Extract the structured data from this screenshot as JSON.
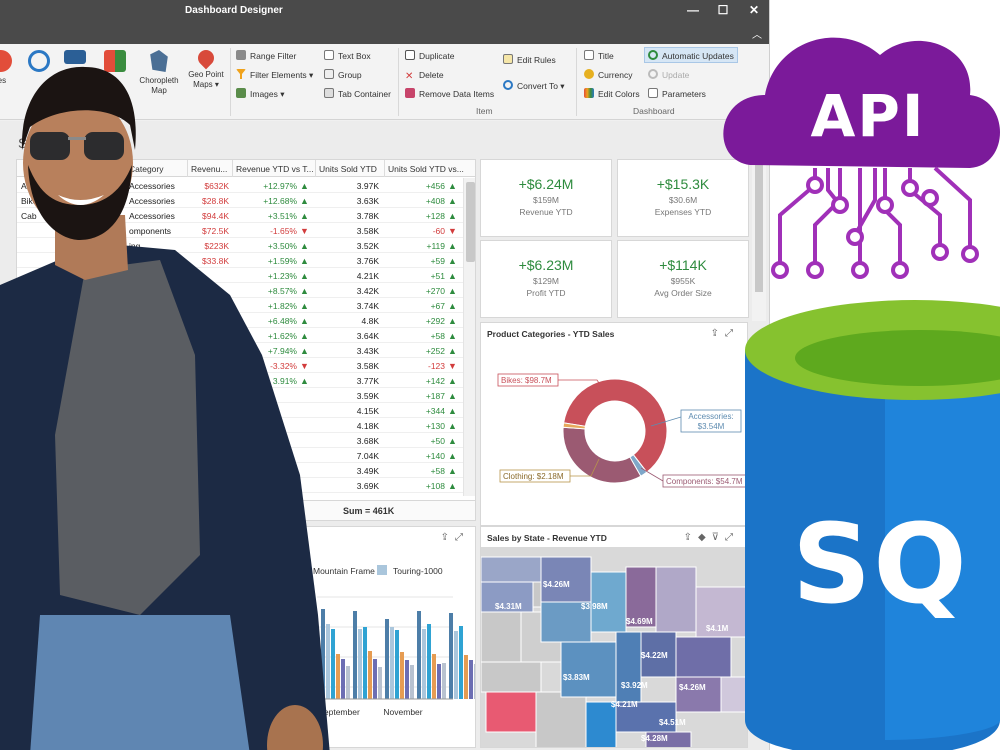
{
  "window": {
    "title": "Dashboard Designer",
    "controls": [
      "—",
      "☐",
      "✕"
    ],
    "ribbon_collapse": "︿"
  },
  "ribbon": {
    "big_buttons": [
      {
        "label": "ies"
      },
      {
        "label": ""
      },
      {
        "label": ""
      },
      {
        "label": "p"
      },
      {
        "label": "Choropleth Map"
      },
      {
        "label": "Geo Point Maps ▾"
      }
    ],
    "filter_group": [
      "Range Filter",
      "Filter Elements ▾",
      "Images ▾"
    ],
    "layout_group": [
      "Text Box",
      "Group",
      "Tab Container"
    ],
    "item_group": [
      "Duplicate",
      "Delete",
      "Remove Data Items",
      "Edit Rules",
      "Convert To ▾"
    ],
    "dashboard_group": [
      "Title",
      "Currency",
      "Edit Colors",
      "Automatic Updates",
      "Update",
      "Parameters"
    ],
    "group_labels": {
      "insert": "rt",
      "item": "Item",
      "dashboard": "Dashboard"
    }
  },
  "grid": {
    "partial_title": "S",
    "headers": [
      "Category",
      "Revenu...",
      "Revenue YTD vs T...",
      "Units Sold YTD",
      "Units Sold YTD vs..."
    ],
    "rows": [
      {
        "product": "A",
        "category": "Accessories",
        "rev": "$632K",
        "rev_neg": false,
        "vs": "+12.97%",
        "units": "3.97K",
        "uvs": "+456"
      },
      {
        "product": "Bike",
        "category": "Accessories",
        "rev": "$28.8K",
        "rev_neg": false,
        "vs": "+12.68%",
        "units": "3.63K",
        "uvs": "+408"
      },
      {
        "product": "Cab",
        "category": "Accessories",
        "rev": "$94.4K",
        "rev_neg": false,
        "vs": "+3.51%",
        "units": "3.78K",
        "uvs": "+128"
      },
      {
        "product": "",
        "category": "omponents",
        "rev": "$72.5K",
        "rev_neg": false,
        "vs": "-1.65%",
        "units": "3.58K",
        "uvs": "-60"
      },
      {
        "product": "",
        "category": "ing",
        "rev": "$223K",
        "rev_neg": false,
        "vs": "+3.50%",
        "units": "3.52K",
        "uvs": "+119"
      },
      {
        "product": "",
        "category": "",
        "rev": "$33.8K",
        "rev_neg": false,
        "vs": "+1.59%",
        "units": "3.76K",
        "uvs": "+59"
      },
      {
        "product": "",
        "category": "",
        "rev": "",
        "rev_neg": false,
        "vs": "+1.23%",
        "units": "4.21K",
        "uvs": "+51"
      },
      {
        "product": "",
        "category": "",
        "rev": "",
        "rev_neg": false,
        "vs": "+8.57%",
        "units": "3.42K",
        "uvs": "+270"
      },
      {
        "product": "",
        "category": "",
        "rev": "",
        "rev_neg": false,
        "vs": "+1.82%",
        "units": "3.74K",
        "uvs": "+67"
      },
      {
        "product": "",
        "category": "",
        "rev": "",
        "rev_neg": false,
        "vs": "+6.48%",
        "units": "4.8K",
        "uvs": "+292"
      },
      {
        "product": "",
        "category": "",
        "rev": "",
        "rev_neg": false,
        "vs": "+1.62%",
        "units": "3.64K",
        "uvs": "+58"
      },
      {
        "product": "",
        "category": "",
        "rev": "",
        "rev_neg": false,
        "vs": "+7.94%",
        "units": "3.43K",
        "uvs": "+252"
      },
      {
        "product": "",
        "category": "",
        "rev": "",
        "rev_neg": false,
        "vs": "-3.32%",
        "units": "3.58K",
        "uvs": "-123"
      },
      {
        "product": "",
        "category": "",
        "rev": "",
        "rev_neg": false,
        "vs": "3.91%",
        "units": "3.77K",
        "uvs": "+142"
      },
      {
        "product": "",
        "category": "",
        "rev": "",
        "rev_neg": false,
        "vs": "",
        "units": "3.59K",
        "uvs": "+187"
      },
      {
        "product": "",
        "category": "",
        "rev": "",
        "rev_neg": false,
        "vs": "",
        "units": "4.15K",
        "uvs": "+344"
      },
      {
        "product": "",
        "category": "",
        "rev": "",
        "rev_neg": false,
        "vs": "",
        "units": "4.18K",
        "uvs": "+130"
      },
      {
        "product": "",
        "category": "",
        "rev": "",
        "rev_neg": false,
        "vs": "",
        "units": "3.68K",
        "uvs": "+50"
      },
      {
        "product": "",
        "category": "",
        "rev": "",
        "rev_neg": false,
        "vs": "",
        "units": "7.04K",
        "uvs": "+140"
      },
      {
        "product": "",
        "category": "",
        "rev": "",
        "rev_neg": false,
        "vs": "",
        "units": "3.49K",
        "uvs": "+58"
      },
      {
        "product": "",
        "category": "",
        "rev": "",
        "rev_neg": false,
        "vs": "",
        "units": "3.69K",
        "uvs": "+108"
      }
    ],
    "sum": "Sum = 461K"
  },
  "cards": [
    {
      "value": "+$6.24M",
      "sub": "$159M",
      "label": "Revenue YTD"
    },
    {
      "value": "+$15.3K",
      "sub": "$30.6M",
      "label": "Expenses YTD"
    },
    {
      "value": "+$6.23M",
      "sub": "$129M",
      "label": "Profit YTD"
    },
    {
      "value": "+$114K",
      "sub": "$955K",
      "label": "Avg Order Size"
    }
  ],
  "pie": {
    "title": "Product Categories - YTD Sales",
    "labels": {
      "bikes": "Bikes: $98.7M",
      "accessories_1": "Accessories:",
      "accessories_2": "$3.54M",
      "clothing": "Clothing: $2.18M",
      "components": "Components: $54.7M"
    }
  },
  "bar": {
    "legend": [
      "Mountain Frame",
      "Touring-1000"
    ],
    "x_labels": [
      "September",
      "November"
    ]
  },
  "map": {
    "title": "Sales by State - Revenue YTD",
    "labels": [
      "$4.26M",
      "$4.31M",
      "$3.98M",
      "$4.69M",
      "$4.1M",
      "$4.22M",
      "$3.83M",
      "$3.92M",
      "$4.26M",
      "$4.21M",
      "$4.51M",
      "$4.28M"
    ]
  },
  "chart_data": [
    {
      "type": "pie",
      "title": "Product Categories - YTD Sales",
      "categories": [
        "Bikes",
        "Accessories",
        "Clothing",
        "Components"
      ],
      "values": [
        98.7,
        3.54,
        2.18,
        54.7
      ],
      "colors": [
        "#c8505a",
        "#7fa7c9",
        "#e6a95b",
        "#9b5a72"
      ],
      "unit": "$M"
    },
    {
      "type": "bar",
      "categories": [
        "",
        "September",
        "",
        "November",
        ""
      ],
      "series": [
        {
          "name": "Mountain Frame",
          "color": "#4d7ea8",
          "values": [
            90,
            88,
            80,
            88,
            86
          ]
        },
        {
          "name": "Touring-1000",
          "color": "#aac6dc",
          "values": [
            75,
            70,
            72,
            70,
            68
          ]
        },
        {
          "name": "",
          "color": "#2fa3d3",
          "values": [
            70,
            72,
            69,
            75,
            73
          ]
        },
        {
          "name": "",
          "color": "#e69c52",
          "values": [
            45,
            48,
            47,
            45,
            44
          ]
        },
        {
          "name": "",
          "color": "#6c6eb3",
          "values": [
            40,
            40,
            39,
            35,
            39
          ]
        },
        {
          "name": "",
          "color": "#b8c2d0",
          "values": [
            33,
            32,
            34,
            36,
            35
          ]
        }
      ],
      "ylim": [
        0,
        100
      ]
    }
  ],
  "logos": {
    "api_text": "API",
    "api_colors": [
      "#7b1a9a",
      "#a030b8"
    ],
    "sql_text": "SQ",
    "sql_colors": [
      "#1b74c8",
      "#86c22f"
    ]
  }
}
